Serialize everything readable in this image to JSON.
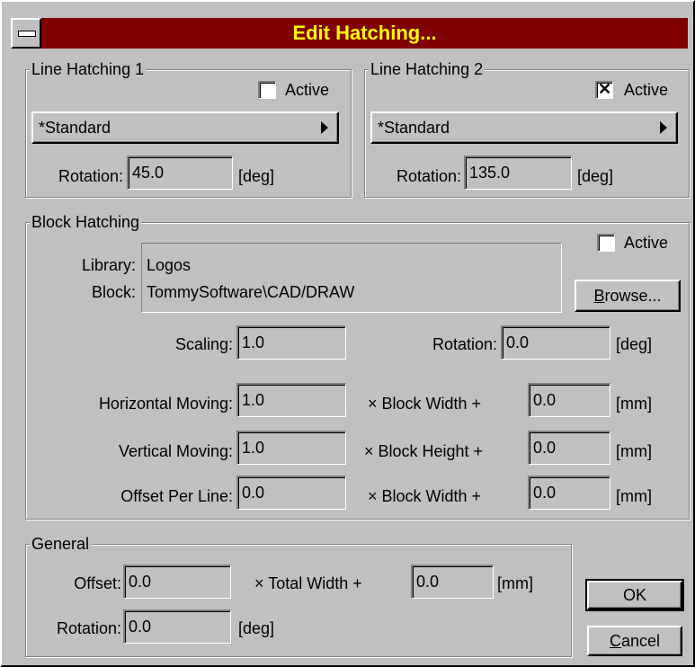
{
  "window": {
    "title": "Edit Hatching..."
  },
  "line_hatching_1": {
    "legend": "Line Hatching 1",
    "active_label": "Active",
    "active_checked": false,
    "pattern": "*Standard",
    "rotation_label": "Rotation:",
    "rotation_value": "45.0",
    "rotation_unit": "[deg]"
  },
  "line_hatching_2": {
    "legend": "Line Hatching 2",
    "active_label": "Active",
    "active_checked": true,
    "pattern": "*Standard",
    "rotation_label": "Rotation:",
    "rotation_value": "135.0",
    "rotation_unit": "[deg]"
  },
  "block_hatching": {
    "legend": "Block Hatching",
    "active_label": "Active",
    "active_checked": false,
    "library_label": "Library:",
    "library_value": "Logos",
    "block_label": "Block:",
    "block_value": "TommySoftware\\CAD/DRAW",
    "browse_label_prefix": "B",
    "browse_label_rest": "rowse...",
    "scaling_label": "Scaling:",
    "scaling_value": "1.0",
    "rotation_label": "Rotation:",
    "rotation_value": "0.0",
    "rotation_unit": "[deg]",
    "horizontal_label": "Horizontal Moving:",
    "horizontal_value": "1.0",
    "horizontal_mult": "× Block Width +",
    "horizontal_add": "0.0",
    "horizontal_unit": "[mm]",
    "vertical_label": "Vertical Moving:",
    "vertical_value": "1.0",
    "vertical_mult": "× Block Height +",
    "vertical_add": "0.0",
    "vertical_unit": "[mm]",
    "offset_label": "Offset Per Line:",
    "offset_value": "0.0",
    "offset_mult": "× Block Width +",
    "offset_add": "0.0",
    "offset_unit": "[mm]"
  },
  "general": {
    "legend": "General",
    "offset_label": "Offset:",
    "offset_value": "0.0",
    "offset_mult": "× Total Width +",
    "offset_add": "0.0",
    "offset_unit": "[mm]",
    "rotation_label": "Rotation:",
    "rotation_value": "0.0",
    "rotation_unit": "[deg]"
  },
  "buttons": {
    "ok": "OK",
    "cancel_prefix": "C",
    "cancel_rest": "ancel"
  },
  "colors": {
    "titlebar": "#800000",
    "title_text": "#ffff00",
    "face": "#c0c0c0"
  }
}
